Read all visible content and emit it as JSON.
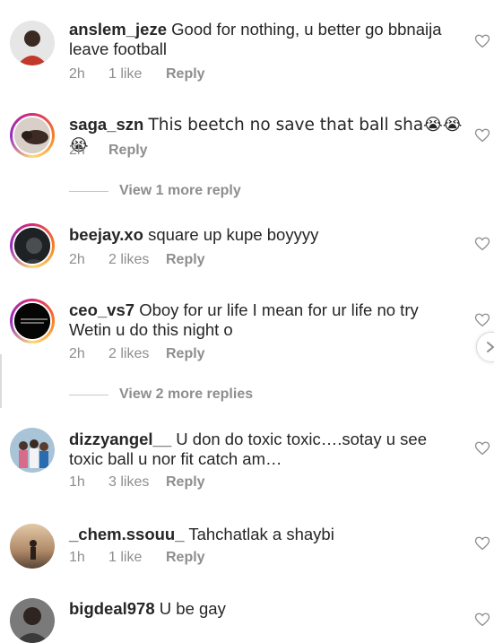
{
  "comments": [
    {
      "username": "anslem_jeze",
      "text": "Good for nothing, u better go bbnaija leave football",
      "time": "2h",
      "likes": "1 like",
      "reply": "Reply",
      "avatar": "avatar-man-red-shirt"
    },
    {
      "username": "saga_szn",
      "text": "This beetch no save that ball sha😭😭😭",
      "time": "2h",
      "likes": "",
      "reply": "Reply",
      "avatar": "avatar-person-lying"
    },
    {
      "username": "beejay.xo",
      "text": "square up kupe boyyyy",
      "time": "2h",
      "likes": "2 likes",
      "reply": "Reply",
      "avatar": "avatar-dark-portrait"
    },
    {
      "username": "ceo_vs7",
      "text": "Oboy for ur life I mean for ur life no try Wetin u do this night o",
      "time": "2h",
      "likes": "2 likes",
      "reply": "Reply",
      "avatar": "avatar-black-text"
    },
    {
      "username": "dizzyangel__",
      "text": "U don do toxic toxic….sotay u see toxic ball u nor fit catch am…",
      "time": "1h",
      "likes": "3 likes",
      "reply": "Reply",
      "avatar": "avatar-group-photo"
    },
    {
      "username": "_chem.ssouu_",
      "text": "Tahchatlak a shaybi",
      "time": "1h",
      "likes": "1 like",
      "reply": "Reply",
      "avatar": "avatar-sunset-silhouette"
    },
    {
      "username": "bigdeal978",
      "text": "U be gay",
      "time": "",
      "likes": "",
      "reply": "",
      "avatar": "avatar-man-dark"
    }
  ],
  "view_more": [
    {
      "label": "View 1 more reply"
    },
    {
      "label": "View 2 more replies"
    }
  ],
  "colors": {
    "text": "#262626",
    "muted": "#8e8e8e",
    "story_ring": "#d62976"
  },
  "icons": {
    "like": "heart-outline-icon",
    "next": "chevron-right-icon"
  }
}
